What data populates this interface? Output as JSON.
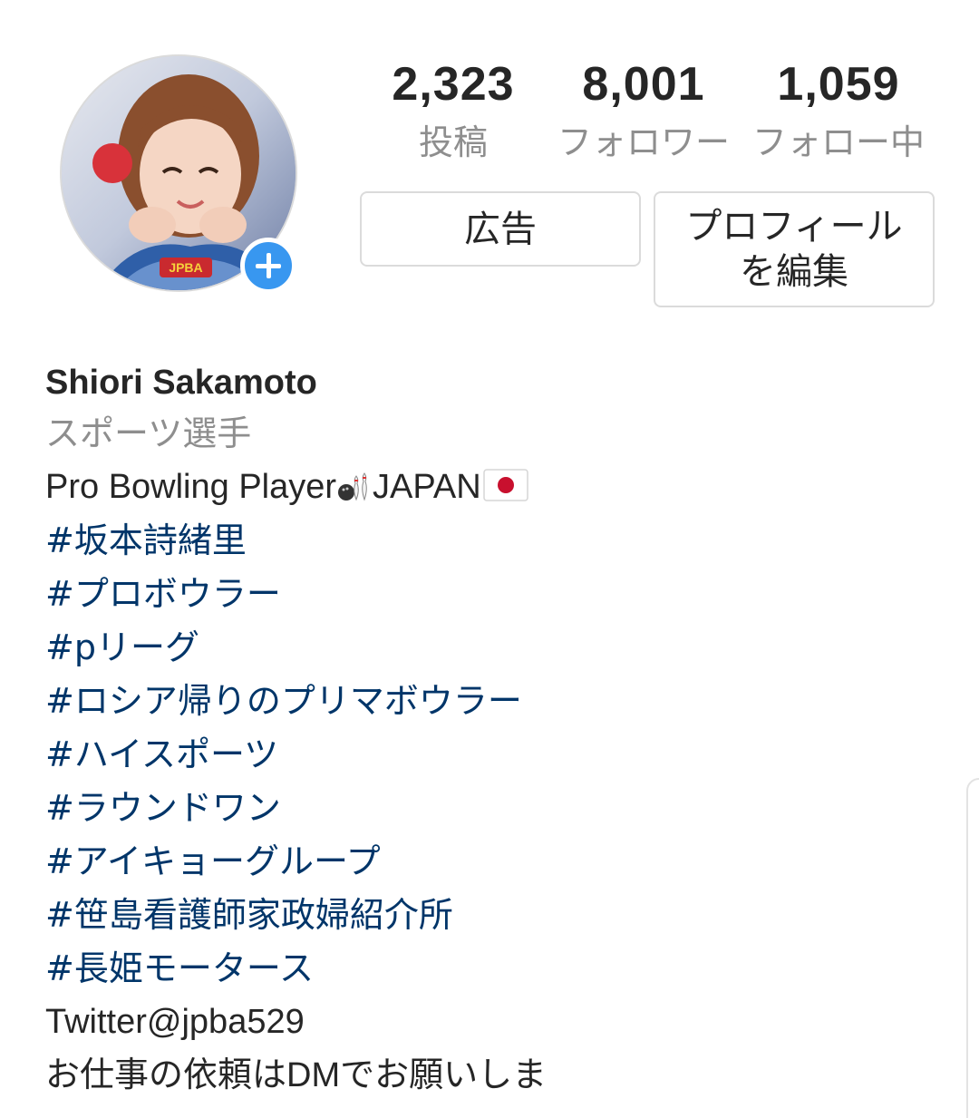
{
  "profile": {
    "avatar_alt": "profile-photo",
    "add_story_icon": "plus-icon"
  },
  "stats": {
    "posts": {
      "value": "2,323",
      "label": "投稿"
    },
    "followers": {
      "value": "8,001",
      "label": "フォロワー"
    },
    "following": {
      "value": "1,059",
      "label": "フォロー中"
    }
  },
  "buttons": {
    "ad": "広告",
    "edit_profile": "プロフィール\nを編集"
  },
  "bio": {
    "name": "Shiori Sakamoto",
    "category": "スポーツ選手",
    "description_text": "Pro Bowling Player",
    "description_suffix": "JAPAN",
    "hashtags": [
      "#坂本詩緒里",
      "#プロボウラー",
      "#pリーグ",
      "#ロシア帰りのプリマボウラー",
      "#ハイスポーツ",
      "#ラウンドワン",
      "#アイキョーグループ",
      "#笹島看護師家政婦紹介所",
      "#長姫モータース"
    ],
    "twitter": "Twitter@jpba529",
    "request": "お仕事の依頼はDMでお願いしま"
  },
  "colors": {
    "accent": "#3897f0",
    "hashtag": "#003569",
    "muted": "#8e8e8e",
    "text": "#262626",
    "border": "#dbdbdb"
  }
}
